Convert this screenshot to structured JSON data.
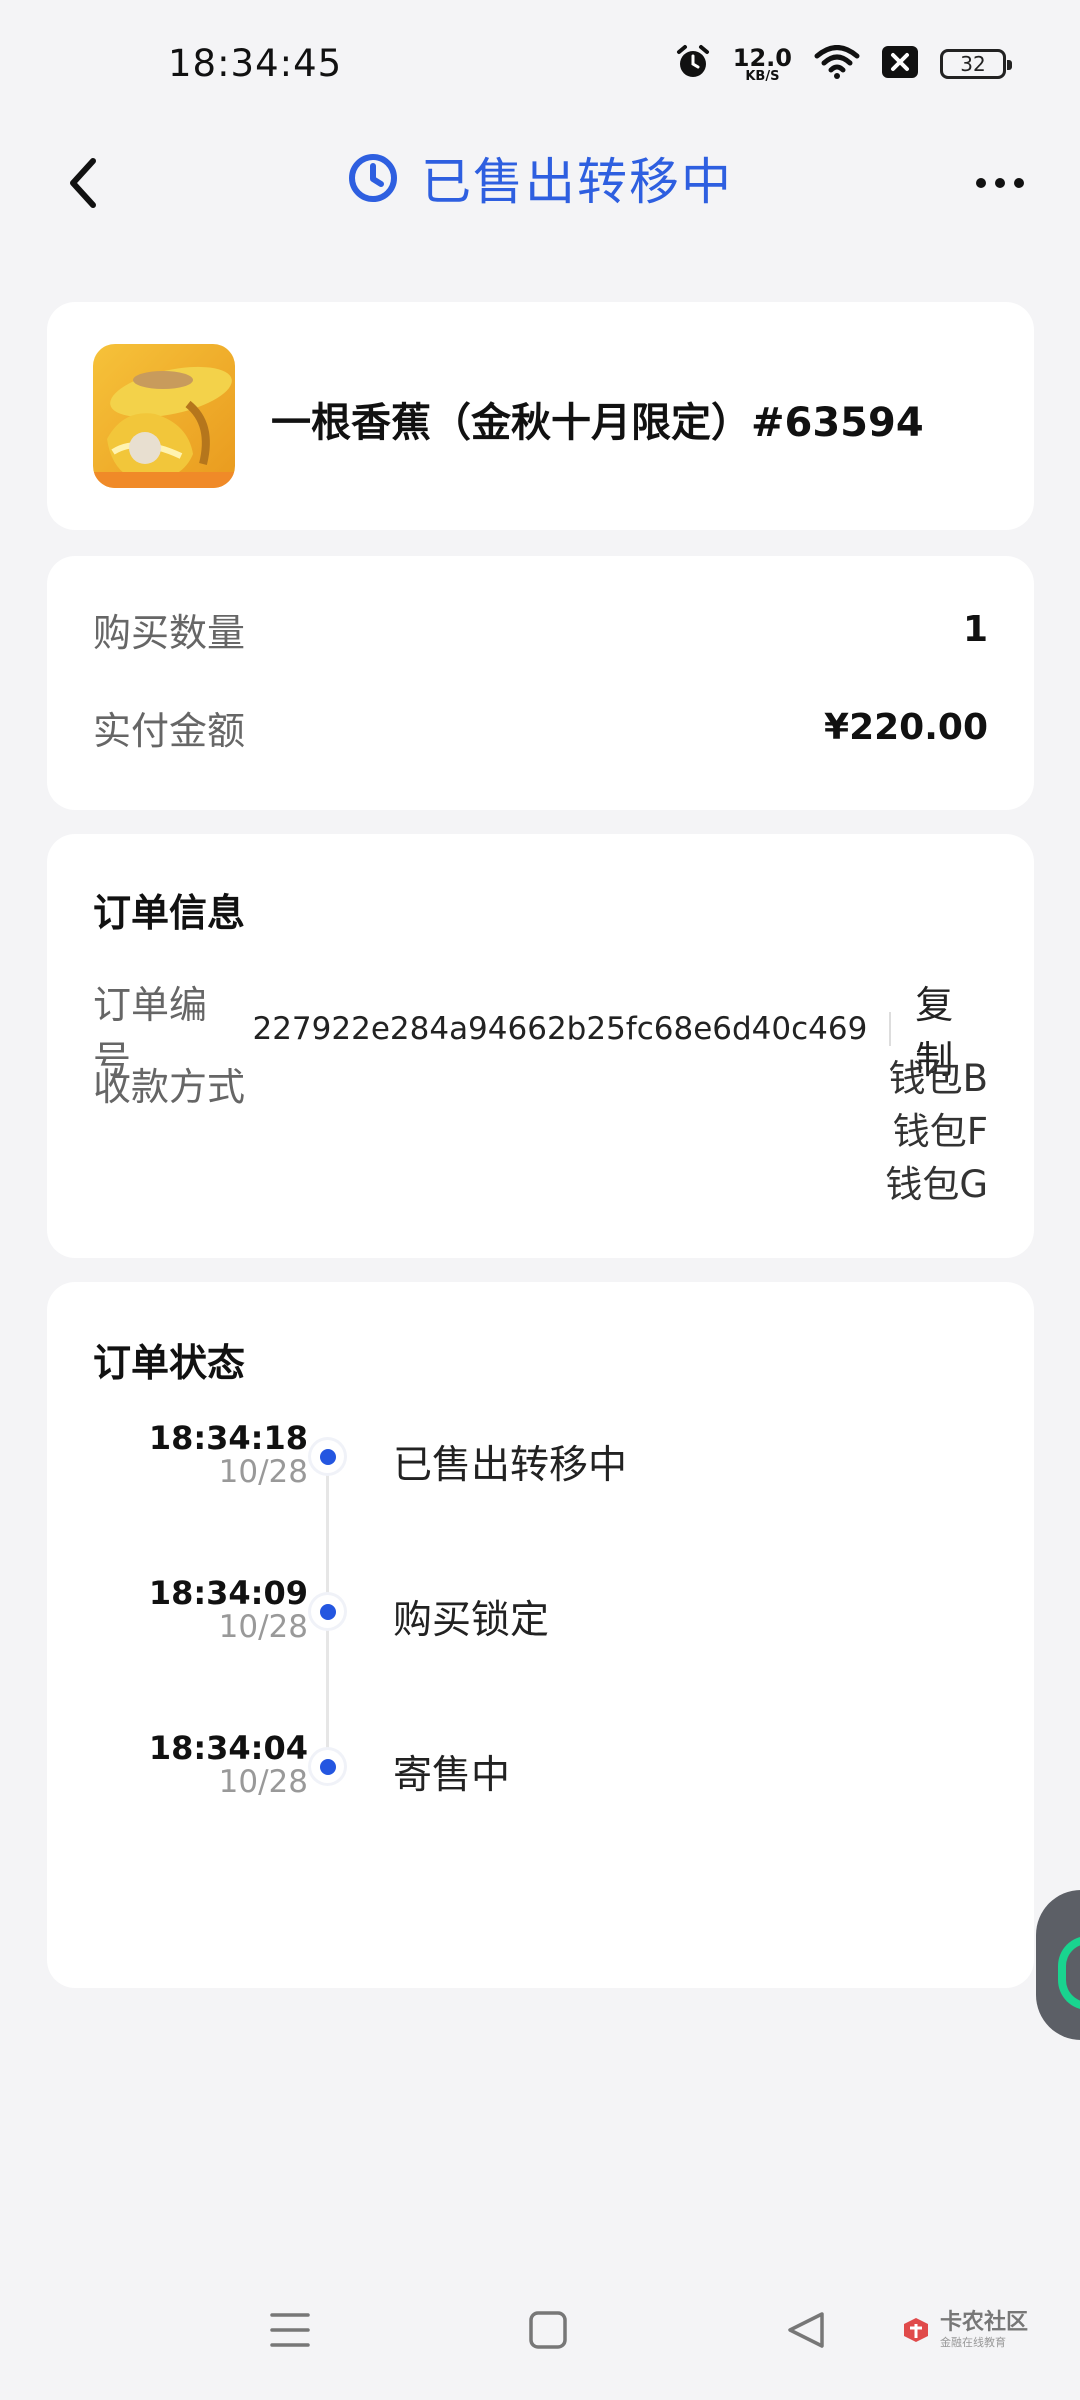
{
  "status_bar": {
    "time": "18:34:45",
    "net_speed_value": "12.0",
    "net_speed_unit": "KB/S",
    "battery": "32",
    "icons": [
      "alarm-icon",
      "wifi-icon",
      "notification-x-icon",
      "battery-icon"
    ]
  },
  "header": {
    "title": "已售出转移中",
    "icons": [
      "back-chevron-icon",
      "clock-icon",
      "more-dots-icon"
    ],
    "accent_color": "#2e5fe0"
  },
  "product": {
    "name": "一根香蕉（金秋十月限定）#63594"
  },
  "amount": {
    "quantity_label": "购买数量",
    "quantity_value": "1",
    "paid_label": "实付金额",
    "paid_value": "¥220.00"
  },
  "order_info": {
    "title": "订单信息",
    "order_no_label": "订单编号",
    "order_no_value": "227922e284a94662b25fc68e6d40c469",
    "copy_label": "复制",
    "payment_label": "收款方式",
    "wallets": [
      "钱包B",
      "钱包F",
      "钱包G"
    ]
  },
  "order_status": {
    "title": "订单状态",
    "items": [
      {
        "time": "18:34:18",
        "date": "10/28",
        "label": "已售出转移中"
      },
      {
        "time": "18:34:09",
        "date": "10/28",
        "label": "购买锁定"
      },
      {
        "time": "18:34:04",
        "date": "10/28",
        "label": "寄售中"
      }
    ],
    "dot_color": "#2456e0"
  },
  "watermark": {
    "title": "卡农社区",
    "subtitle": "金融在线教育"
  }
}
